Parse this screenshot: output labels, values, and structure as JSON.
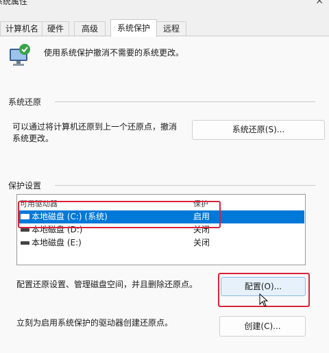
{
  "window": {
    "title": "系统属性"
  },
  "tabs": [
    {
      "label": "计算机名"
    },
    {
      "label": "硬件"
    },
    {
      "label": "高级"
    },
    {
      "label": "系统保护"
    },
    {
      "label": "远程"
    }
  ],
  "intro": {
    "text": "使用系统保护撤消不需要的系统更改。"
  },
  "restore": {
    "section_label": "系统还原",
    "description_line1": "可以通过将计算机还原到上一个还原点，撤消",
    "description_line2": "系统更改。",
    "button_label": "系统还原(S)..."
  },
  "protection": {
    "section_label": "保护设置",
    "columns": {
      "drive": "可用驱动器",
      "protection": "保护"
    },
    "drives": [
      {
        "name": "本地磁盘 (C:) (系统)",
        "status": "启用"
      },
      {
        "name": "本地磁盘 (D:)",
        "status": "关闭"
      },
      {
        "name": "本地磁盘 (E:)",
        "status": "关闭"
      }
    ],
    "config_text": "配置还原设置、管理磁盘空间，并且删除还原点。",
    "config_button": "配置(O)...",
    "create_text": "立刻为启用系统保护的驱动器创建还原点。",
    "create_button": "创建(C)..."
  },
  "colors": {
    "selection": "#0078d7",
    "highlight_box": "#d8233a"
  }
}
